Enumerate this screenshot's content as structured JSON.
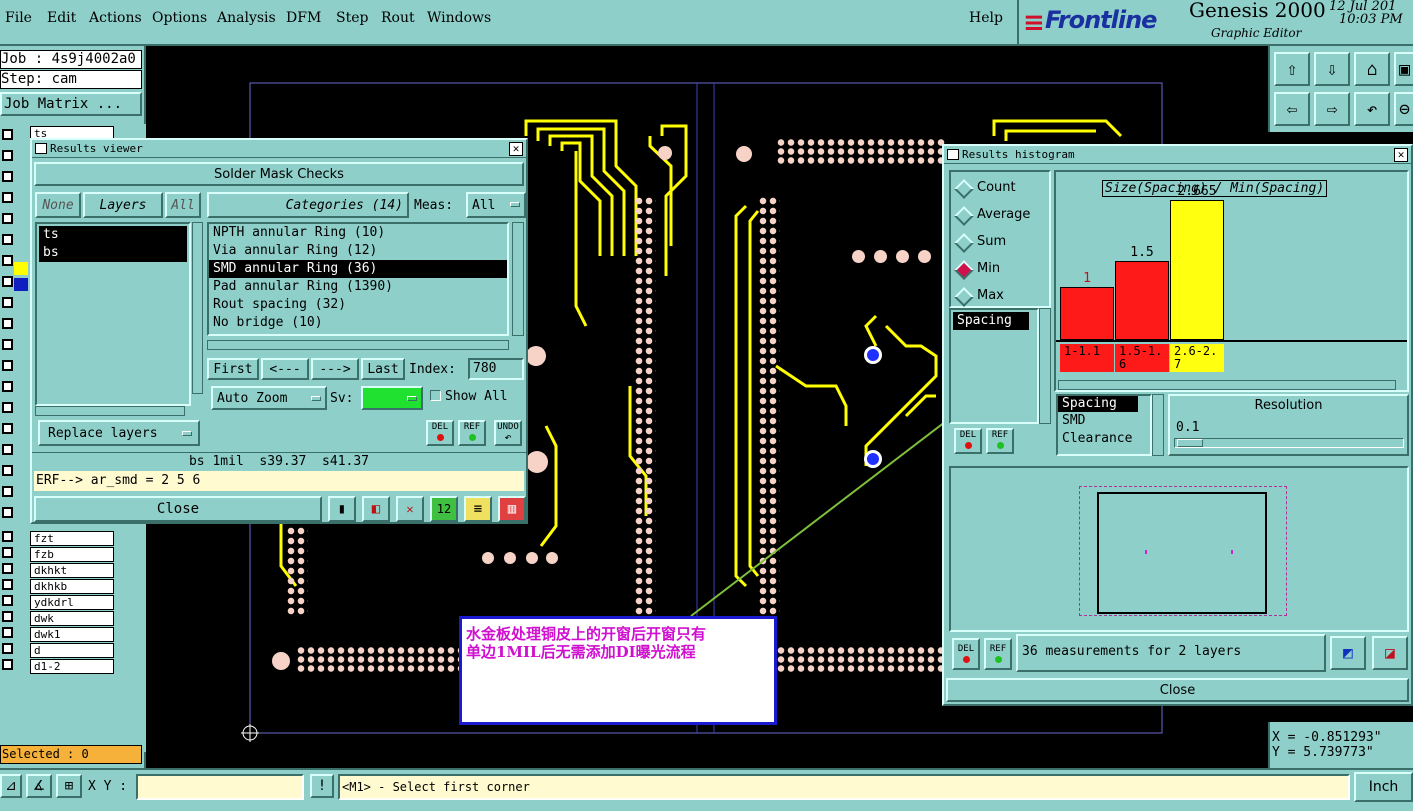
{
  "menu": {
    "items": [
      "File",
      "Edit",
      "Actions",
      "Options",
      "Analysis",
      "DFM",
      "Step",
      "Rout",
      "Windows"
    ],
    "help": "Help"
  },
  "brand": {
    "logo": "Frontline",
    "product": "Genesis 2000",
    "subtitle": "Graphic Editor",
    "date": "12 Jul 201",
    "time": "10:03 PM"
  },
  "left_panel": {
    "job": "Job : 4s9j4002a0",
    "step": "Step: cam",
    "job_matrix": "Job Matrix ...",
    "first_layer": "ts",
    "layers": [
      "fzt",
      "fzb",
      "dkhkt",
      "dkhkb",
      "ydkdrl",
      "dwk",
      "dwk1",
      "d",
      "d1-2"
    ],
    "selected": "Selected : 0"
  },
  "results_viewer": {
    "title": "Results viewer",
    "heading": "Solder Mask Checks",
    "none_btn": "None",
    "layers_btn": "Layers",
    "all_btn": "All",
    "categories_btn": "Categories (14)",
    "meas_label": "Meas:",
    "meas_value": "All",
    "layer_list": [
      "ts",
      "bs"
    ],
    "categories": [
      "NPTH annular Ring (10)",
      "Via annular Ring (12)",
      "SMD annular Ring (36)",
      "Pad annular Ring (1390)",
      "Rout spacing (32)",
      "No bridge (10)"
    ],
    "first_btn": "First",
    "prev_btn": "<---",
    "next_btn": "--->",
    "last_btn": "Last",
    "index_label": "Index:",
    "index_value": "780",
    "auto_zoom": "Auto Zoom",
    "sv_label": "Sv:",
    "show_all": "Show All",
    "replace_layers": "Replace layers",
    "del": "DEL",
    "ref": "REF",
    "undo": "UNDO",
    "status": "bs 1mil  s39.37  s41.37",
    "erf": "ERF--> ar_smd = 2 5 6",
    "close": "Close"
  },
  "histogram": {
    "title": "Results histogram",
    "radios": [
      "Count",
      "Average",
      "Sum",
      "Min",
      "Max"
    ],
    "selected_radio": "Min",
    "measure_list": [
      "Spacing"
    ],
    "chart_title": "Size(Spacing) / Min(Spacing)",
    "bars": [
      {
        "range": "1-1.1",
        "value": "1",
        "color": "#ff1a1a"
      },
      {
        "range": "1.5-1.6",
        "value": "1.5",
        "color": "#ff1a1a"
      },
      {
        "range": "2.6-2.7",
        "value": "2.665",
        "color": "#ffff10"
      }
    ],
    "size_list": [
      "Spacing",
      "SMD",
      "Clearance"
    ],
    "resolution_label": "Resolution",
    "resolution_value": "0.1",
    "measurements": "36 measurements for 2 layers",
    "close": "Close"
  },
  "annotation": {
    "line1": "水金板处理铜皮上的开窗后开窗只有",
    "line2": "单边1MIL后无需添加DI曝光流程"
  },
  "coords": {
    "x": "X = -0.851293\"",
    "y": "Y = 5.739773\""
  },
  "statusbar": {
    "xy_label": "X Y :",
    "prompt": "<M1> - Select first corner",
    "units": "Inch"
  }
}
